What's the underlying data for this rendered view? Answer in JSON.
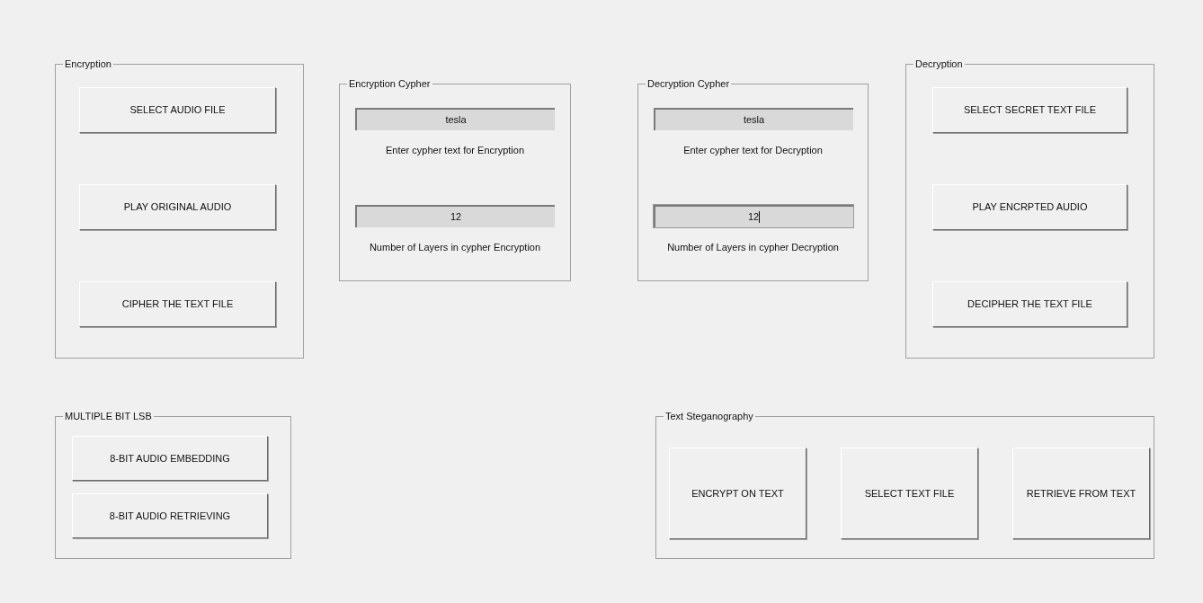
{
  "encryption": {
    "title": "Encryption",
    "buttons": [
      "SELECT AUDIO FILE",
      "PLAY ORIGINAL AUDIO",
      "CIPHER THE TEXT FILE"
    ]
  },
  "encryption_cypher": {
    "title": "Encryption Cypher",
    "fields": [
      {
        "value": "tesla",
        "label": "Enter cypher text for Encryption",
        "focused": false
      },
      {
        "value": "12",
        "label": "Number of Layers in cypher Encryption",
        "focused": false
      }
    ]
  },
  "decryption_cypher": {
    "title": "Decryption Cypher",
    "fields": [
      {
        "value": "tesla",
        "label": "Enter cypher text for Decryption",
        "focused": false
      },
      {
        "value": "12",
        "label": "Number of Layers in cypher Decryption",
        "focused": true
      }
    ]
  },
  "decryption": {
    "title": "Decryption",
    "buttons": [
      "SELECT SECRET TEXT FILE",
      "PLAY ENCRPTED AUDIO",
      "DECIPHER THE TEXT FILE"
    ]
  },
  "multiple_bit_lsb": {
    "title": "MULTIPLE BIT LSB",
    "buttons": [
      "8-BIT AUDIO EMBEDDING",
      "8-BIT AUDIO RETRIEVING"
    ]
  },
  "text_steganography": {
    "title": "Text Steganography",
    "buttons": [
      "ENCRYPT ON TEXT",
      "SELECT TEXT FILE",
      "RETRIEVE FROM TEXT"
    ]
  }
}
